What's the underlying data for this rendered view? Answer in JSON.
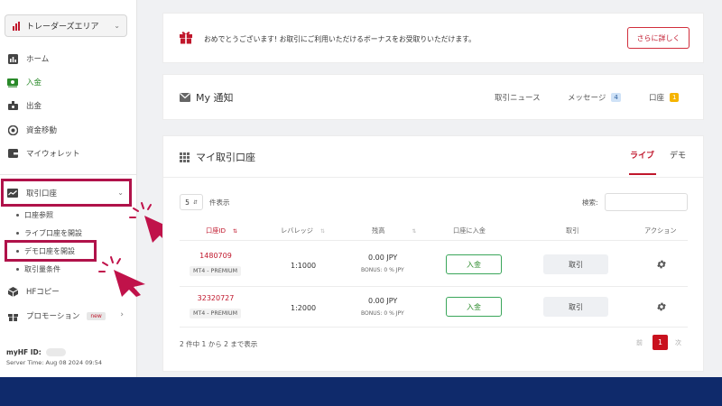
{
  "colors": {
    "brand_red": "#c0172c",
    "green": "#2a8a2a",
    "navy": "#0f2a6b",
    "highlight": "#b0124a"
  },
  "sidebar": {
    "area_select": "トレーダーズエリア",
    "nav": [
      {
        "label": "ホーム",
        "icon": "chart-icon"
      },
      {
        "label": "入金",
        "icon": "deposit-icon"
      },
      {
        "label": "出金",
        "icon": "withdraw-icon"
      },
      {
        "label": "資金移動",
        "icon": "transfer-icon"
      },
      {
        "label": "マイウォレット",
        "icon": "wallet-icon"
      }
    ],
    "accounts_menu": {
      "label": "取引口座",
      "sub_items": [
        "口座参照",
        "ライブ口座を開設",
        "デモ口座を開設",
        "取引量条件"
      ]
    },
    "hf_copy": "HFコピー",
    "promotion": {
      "label": "プロモーション",
      "badge": "new"
    },
    "myhf_label": "myHF ID:",
    "server_time": "Server Time: Aug 08 2024 09:54"
  },
  "bonus_banner": {
    "text": "おめでとうございます! お取引にご利用いただけるボーナスをお受取りいただけます。",
    "button": "さらに詳しく"
  },
  "notifications": {
    "title": "My 通知",
    "tabs": [
      {
        "label": "取引ニュース"
      },
      {
        "label": "メッセージ",
        "count": "4"
      },
      {
        "label": "口座",
        "count": "1"
      }
    ]
  },
  "accounts_card": {
    "title": "マイ取引口座",
    "tab_live": "ライブ",
    "tab_demo": "デモ",
    "page_size": "5",
    "page_size_suffix": "件表示",
    "search_label": "検索:",
    "columns": [
      "口座ID",
      "レバレッジ",
      "残高",
      "口座に入金",
      "取引",
      "アクション"
    ],
    "rows": [
      {
        "id": "1480709",
        "type": "MT4 - PREMIUM",
        "leverage": "1:1000",
        "balance": "0.00 JPY",
        "bonus": "BONUS: 0 % JPY",
        "deposit": "入金",
        "trade": "取引"
      },
      {
        "id": "32320727",
        "type": "MT4 - PREMIUM",
        "leverage": "1:2000",
        "balance": "0.00 JPY",
        "bonus": "BONUS: 0 % JPY",
        "deposit": "入金",
        "trade": "取引"
      }
    ],
    "footer_info": "2 件中 1 から 2 まで表示",
    "pager": {
      "prev": "前",
      "current": "1",
      "next": "次"
    }
  }
}
